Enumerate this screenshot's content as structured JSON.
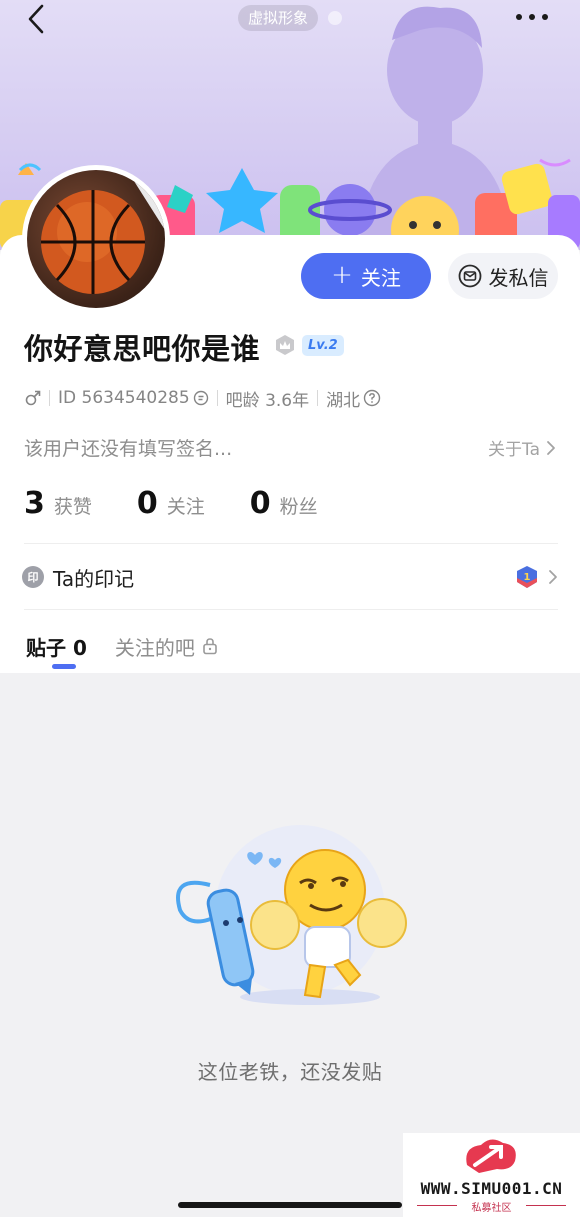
{
  "header": {
    "avatar_mode_label": "虚拟形象"
  },
  "profile": {
    "follow_label": "关注",
    "message_label": "发私信",
    "nickname": "你好意思吧你是谁",
    "level": "Lv.2",
    "id_text": "ID 5634540285",
    "bar_age": "吧龄 3.6年",
    "location": "湖北",
    "signature": "该用户还没有填写签名...",
    "about_link": "关于Ta"
  },
  "stats": [
    {
      "value": "3",
      "label": "获赞"
    },
    {
      "value": "0",
      "label": "关注"
    },
    {
      "value": "0",
      "label": "粉丝"
    }
  ],
  "marks": {
    "seal_char": "印",
    "label": "Ta的印记"
  },
  "tabs": [
    {
      "label": "贴子 0"
    },
    {
      "label": "关注的吧"
    }
  ],
  "empty_state": {
    "message": "这位老铁，还没发贴"
  },
  "watermark": {
    "url": "WWW.SIMU001.CN",
    "name": "私募社区"
  },
  "colors": {
    "accent": "#4e6ef2",
    "banner": "#d6cdf2",
    "page_bg": "#f1f1f3"
  },
  "icons": [
    "back-arrow-icon",
    "more-dots-icon",
    "plus-icon",
    "envelope-icon",
    "crown-icon",
    "male-icon",
    "copy-icon",
    "help-icon",
    "chevron-right-icon",
    "lock-icon",
    "rank-badge-icon"
  ]
}
